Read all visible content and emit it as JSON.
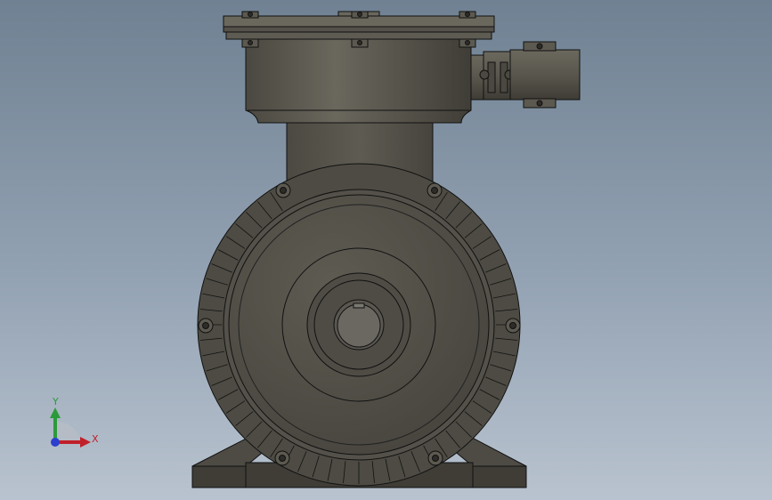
{
  "view": {
    "background_top": "#6f8192",
    "background_bottom": "#b9c3cf",
    "body_color": "#55524a",
    "edge_color": "#111111"
  },
  "triad": {
    "x_label": "X",
    "y_label": "Y",
    "x_color": "#c0202a",
    "y_color": "#2b9a3a",
    "z_color": "#2a3fcf"
  }
}
